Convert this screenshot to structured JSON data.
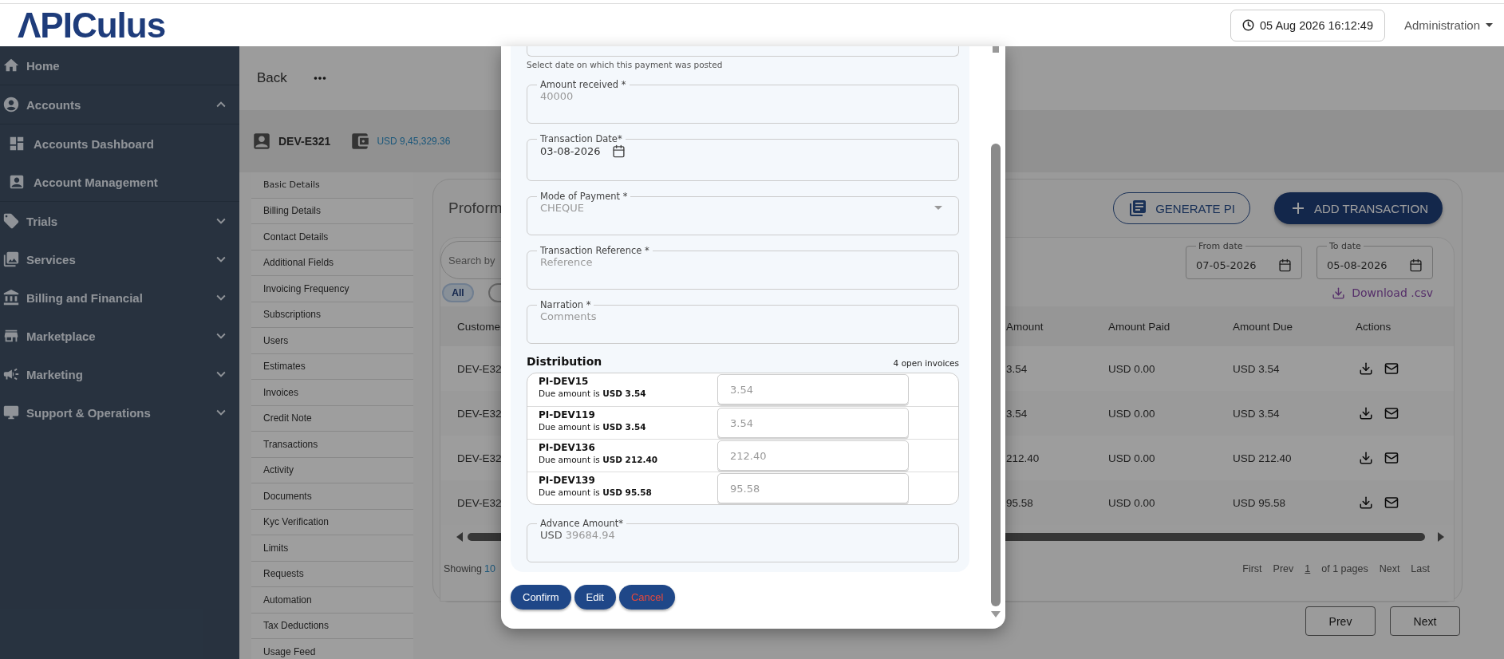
{
  "header": {
    "logo": "ΛPICulus",
    "datetime": "05 Aug 2026 16:12:49",
    "user_menu": "Administration"
  },
  "sidebar": {
    "items": [
      {
        "label": "Home"
      },
      {
        "label": "Accounts",
        "expanded": true,
        "children": [
          {
            "label": "Accounts Dashboard"
          },
          {
            "label": "Account Management"
          }
        ]
      },
      {
        "label": "Trials",
        "expanded": false
      },
      {
        "label": "Services",
        "expanded": false
      },
      {
        "label": "Billing and Financial",
        "expanded": false
      },
      {
        "label": "Marketplace",
        "expanded": false
      },
      {
        "label": "Marketing",
        "expanded": false
      },
      {
        "label": "Support & Operations",
        "expanded": false
      }
    ]
  },
  "page": {
    "back": "Back",
    "customer_id": "DEV-E321",
    "balance": "USD 9,45,329.36"
  },
  "sections": [
    {
      "label": "Basic Details",
      "selected": true
    },
    {
      "label": "Billing Details",
      "selected": false
    },
    {
      "label": "Contact Details",
      "selected": false
    },
    {
      "label": "Additional Fields",
      "selected": false
    },
    {
      "label": "Invoicing Frequency",
      "selected": false
    },
    {
      "label": "Subscriptions",
      "selected": false
    },
    {
      "label": "Users",
      "selected": false
    },
    {
      "label": "Estimates",
      "selected": false
    },
    {
      "label": "Invoices",
      "selected": false
    },
    {
      "label": "Credit Note",
      "selected": false
    },
    {
      "label": "Transactions",
      "selected": false
    },
    {
      "label": "Activity",
      "selected": false
    },
    {
      "label": "Documents",
      "selected": false
    },
    {
      "label": "Kyc Verification",
      "selected": false
    },
    {
      "label": "Limits",
      "selected": false
    },
    {
      "label": "Requests",
      "selected": false
    },
    {
      "label": "Automation",
      "selected": false
    },
    {
      "label": "Tax Deductions",
      "selected": false
    },
    {
      "label": "Usage Feed",
      "selected": false
    }
  ],
  "panel": {
    "title": "Proform",
    "generate_button": "GENERATE PI",
    "add_button": "ADD TRANSACTION",
    "search": {
      "placeholder": "Search by"
    },
    "filters": [
      {
        "label": "All",
        "selected": true
      },
      {
        "selected": false
      }
    ],
    "from_date": {
      "label": "From date",
      "value": "07-05-2026"
    },
    "to_date": {
      "label": "To date",
      "value": "05-08-2026"
    },
    "download": "Download .csv",
    "table": {
      "columns": [
        "Custome",
        "Amount",
        "Amount Paid",
        "Amount Due",
        "Actions"
      ],
      "rows": [
        {
          "customer": "DEV-E32",
          "amount": "3.54",
          "paid": "USD 0.00",
          "due": "USD 3.54"
        },
        {
          "customer": "DEV-E32",
          "amount": "3.54",
          "paid": "USD 0.00",
          "due": "USD 3.54"
        },
        {
          "customer": "DEV-E32",
          "amount": "212.40",
          "paid": "USD 0.00",
          "due": "USD 212.40"
        },
        {
          "customer": "DEV-E32",
          "amount": "95.58",
          "paid": "USD 0.00",
          "due": "USD 95.58"
        }
      ]
    },
    "showing_label": "Showing",
    "showing_count": "10",
    "pager": {
      "first": "First",
      "prev": "Prev",
      "page": "1",
      "total": "of 1 pages",
      "next": "Next",
      "last": "Last"
    }
  },
  "bottom_buttons": [
    "Prev",
    "Next"
  ],
  "modal": {
    "date_hint": "Select date on which this payment was posted",
    "fields": [
      {
        "kind": "text",
        "label": "Amount received *",
        "value": "40000",
        "disabled": true
      },
      {
        "kind": "date",
        "label": "Transaction Date*",
        "value": "03-08-2026",
        "disabled": false
      },
      {
        "kind": "select",
        "label": "Mode of Payment *",
        "value": "CHEQUE",
        "disabled": true
      },
      {
        "kind": "text",
        "label": "Transaction Reference *",
        "placeholder": "Reference"
      },
      {
        "kind": "text",
        "label": "Narration *",
        "placeholder": "Comments"
      }
    ],
    "distribution": {
      "title": "Distribution",
      "count": "4 open invoices",
      "invoices": [
        {
          "id": "PI-DEV15",
          "due": "Due amount is **USD 3.54**",
          "value": "3.54",
          "disabled": true
        },
        {
          "id": "PI-DEV119",
          "due": "Due amount is **USD 3.54**",
          "value": "3.54",
          "disabled": true
        },
        {
          "id": "PI-DEV136",
          "due": "Due amount is **USD 212.40**",
          "value": "212.40",
          "disabled": true
        },
        {
          "id": "PI-DEV139",
          "due": "Due amount is **USD 95.58**",
          "value": "95.58",
          "disabled": true
        }
      ]
    },
    "advance": {
      "label": "Advance Amount*",
      "prefix": "USD",
      "value": "39684.94",
      "disabled": true
    },
    "buttons": [
      {
        "label": "Confirm",
        "kind": "primary"
      },
      {
        "label": "Edit",
        "kind": "primary"
      },
      {
        "label": "Cancel",
        "kind": "danger"
      }
    ]
  }
}
